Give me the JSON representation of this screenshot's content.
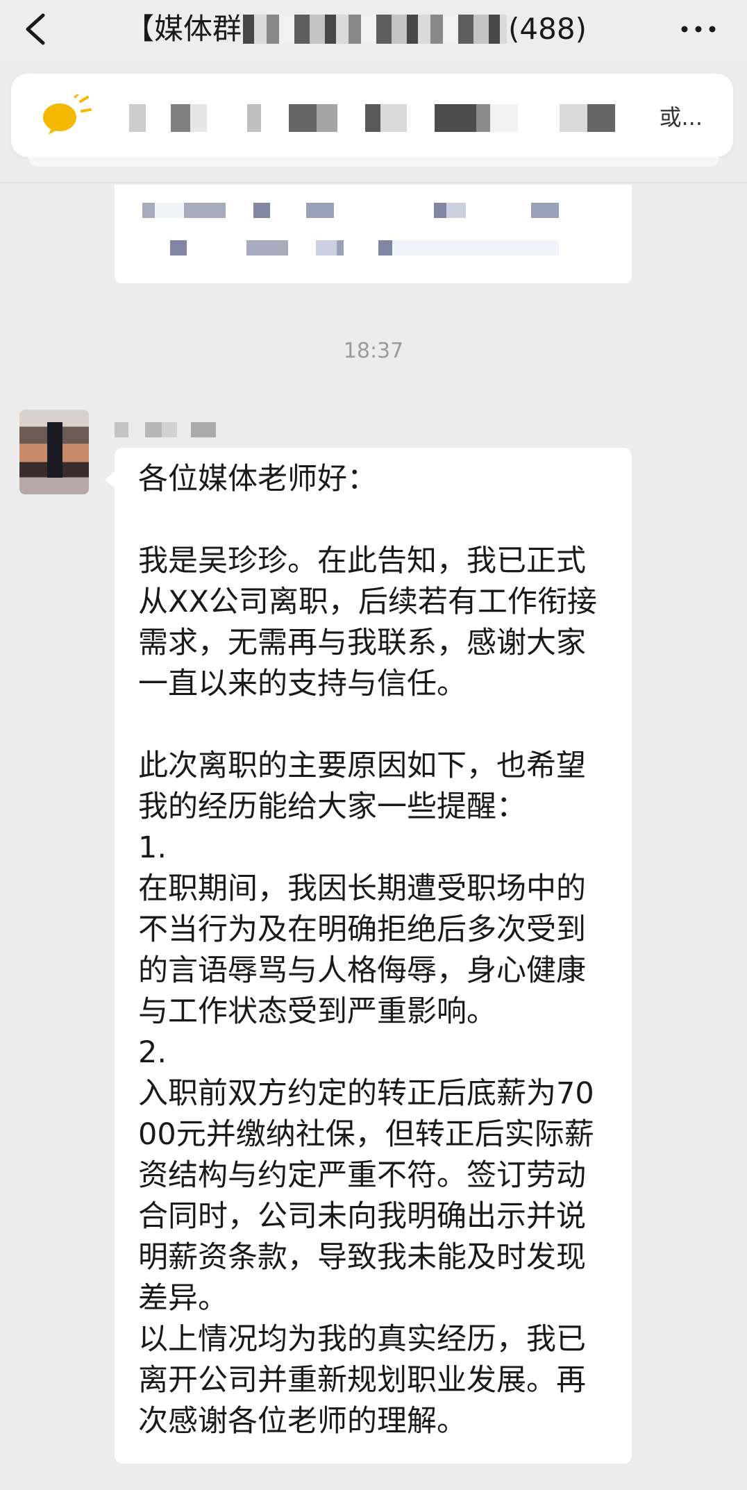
{
  "header": {
    "title_prefix": "【媒体群",
    "title_suffix": "(488)",
    "back_icon": "chevron-left-icon",
    "more_icon": "more-horizontal-icon"
  },
  "announcement": {
    "icon": "announcement-megaphone-icon",
    "trailing_text": "或..."
  },
  "timestamp": "18:37",
  "message": {
    "text": "各位媒体老师好：\n\n我是吴珍珍。在此告知，我已正式从XX公司离职，后续若有工作衔接需求，无需再与我联系，感谢大家一直以来的支持与信任。\n\n此次离职的主要原因如下，也希望我的经历能给大家一些提醒：\n1.\n在职期间，我因长期遭受职场中的不当行为及在明确拒绝后多次受到的言语辱骂与人格侮辱，身心健康与工作状态受到严重影响。\n2.\n入职前双方约定的转正后底薪为7000元并缴纳社保，但转正后实际薪资结构与约定严重不符。签订劳动合同时，公司未向我明确出示并说明薪资条款，导致我未能及时发现差异。\n以上情况均为我的真实经历，我已离开公司并重新规划职业发展。再次感谢各位老师的理解。"
  },
  "colors": {
    "background": "#ececec",
    "bubble": "#ffffff",
    "timestamp": "#9a9a9a",
    "announcement_icon": "#f5b800"
  }
}
